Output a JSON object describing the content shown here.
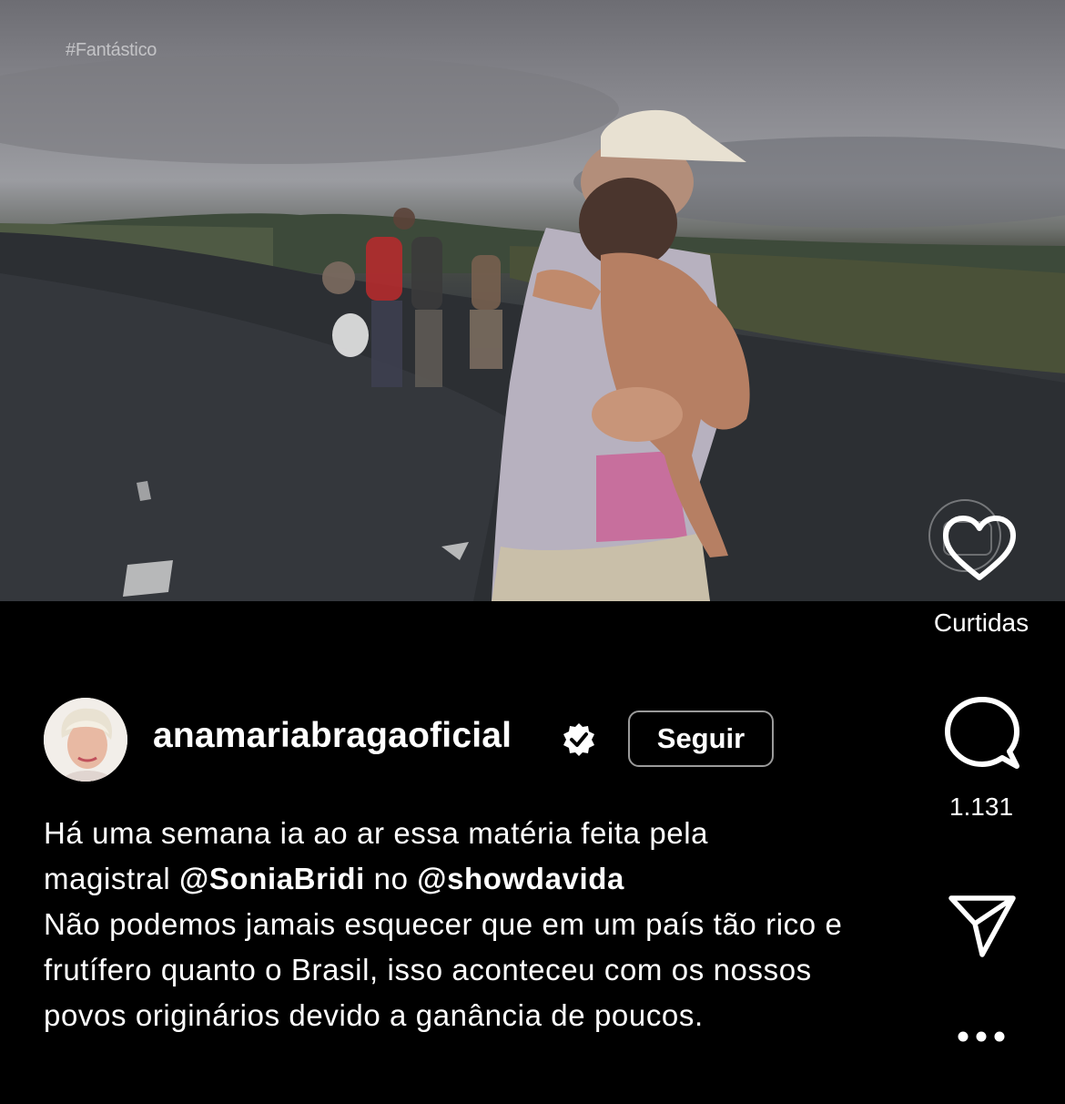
{
  "media": {
    "watermark": "#Fantástico"
  },
  "actions": {
    "likes_label": "Curtidas",
    "comments_count": "1.131"
  },
  "author": {
    "username": "anamariabragaoficial",
    "follow_label": "Seguir"
  },
  "caption": {
    "line1_prefix": "Há uma semana ia ao ar essa matéria feita pela",
    "line2_prefix": "magistral ",
    "mention1": "@SoniaBridi",
    "line2_mid": " no ",
    "mention2": "@showdavida",
    "paragraph2": "Não podemos jamais esquecer que em um país tão rico e frutífero quanto o Brasil, isso aconteceu com os nossos povos originários devido a ganância de poucos."
  },
  "colors": {
    "background": "#000000",
    "text": "#ffffff",
    "follow_border": "#9a9a9a"
  },
  "icons": [
    "heart-icon",
    "comment-icon",
    "send-icon",
    "more-icon",
    "verified-badge-icon"
  ]
}
